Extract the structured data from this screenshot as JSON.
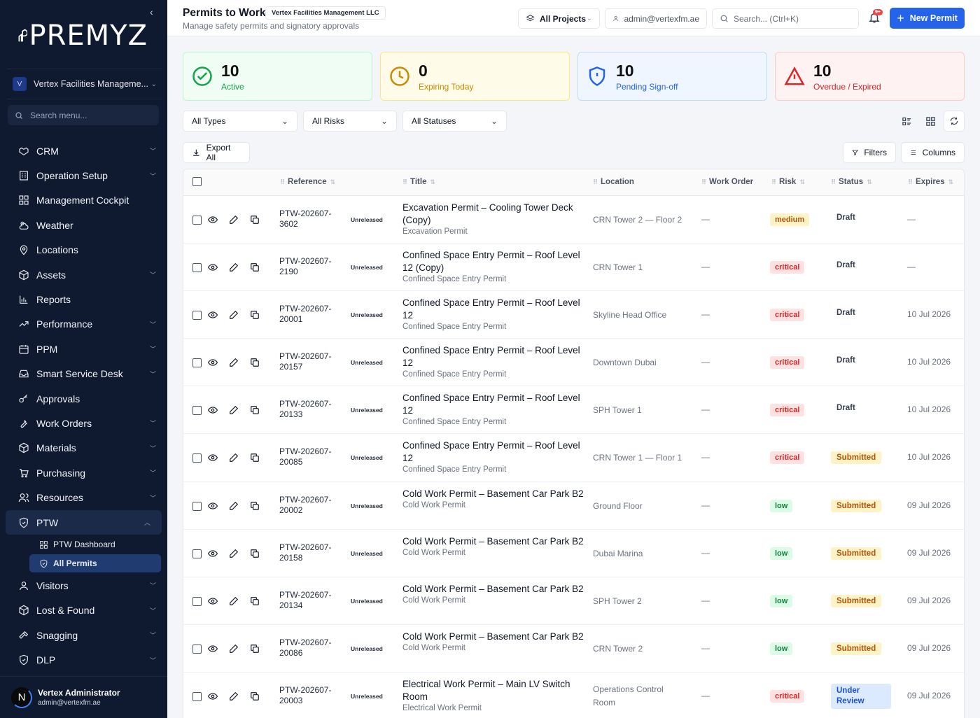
{
  "brand": {
    "logo_text": "PREMYZ"
  },
  "org": {
    "initial": "V",
    "name": "Vertex Facilities Manageme..."
  },
  "menu_search": {
    "placeholder": "Search menu..."
  },
  "nav": [
    {
      "label": "CRM",
      "icon": "handshake-icon",
      "chevron": true
    },
    {
      "label": "Operation Setup",
      "icon": "building-icon",
      "chevron": true
    },
    {
      "label": "Management Cockpit",
      "icon": "grid-icon",
      "chevron": false
    },
    {
      "label": "Weather",
      "icon": "sun-cloud-icon",
      "chevron": false
    },
    {
      "label": "Locations",
      "icon": "map-pin-icon",
      "chevron": false
    },
    {
      "label": "Assets",
      "icon": "box-icon",
      "chevron": true
    },
    {
      "label": "Reports",
      "icon": "bar-chart-icon",
      "chevron": false
    },
    {
      "label": "Performance",
      "icon": "trending-up-icon",
      "chevron": true
    },
    {
      "label": "PPM",
      "icon": "calendar-icon",
      "chevron": true
    },
    {
      "label": "Smart Service Desk",
      "icon": "inbox-icon",
      "chevron": true
    },
    {
      "label": "Approvals",
      "icon": "key-icon",
      "chevron": false
    },
    {
      "label": "Work Orders",
      "icon": "wrench-icon",
      "chevron": true
    },
    {
      "label": "Materials",
      "icon": "package-icon",
      "chevron": true
    },
    {
      "label": "Purchasing",
      "icon": "cart-icon",
      "chevron": true
    },
    {
      "label": "Resources",
      "icon": "users-icon",
      "chevron": true
    },
    {
      "label": "PTW",
      "icon": "shield-icon",
      "chevron": true,
      "active": true
    }
  ],
  "ptw_sub": [
    {
      "label": "PTW Dashboard",
      "icon": "grid-icon"
    },
    {
      "label": "All Permits",
      "icon": "shield-icon",
      "active": true
    }
  ],
  "nav2": [
    {
      "label": "Visitors",
      "icon": "user-icon",
      "chevron": true
    },
    {
      "label": "Lost & Found",
      "icon": "box-icon",
      "chevron": true
    },
    {
      "label": "Snagging",
      "icon": "hammer-icon",
      "chevron": true
    },
    {
      "label": "DLP",
      "icon": "shield-icon",
      "chevron": true
    }
  ],
  "user": {
    "initial": "N",
    "name": "Vertex Administrator",
    "email": "admin@vertexfm.ae"
  },
  "header": {
    "title": "Permits to Work",
    "org_chip": "Vertex Facilities Management LLC",
    "subtitle": "Manage safety permits and signatory approvals",
    "projects": "All Projects",
    "account": "admin@vertexfm.ae",
    "search_placeholder": "Search... (Ctrl+K)",
    "notif_badge": "9+",
    "new_permit": "New Permit"
  },
  "stats": [
    {
      "value": "10",
      "label": "Active",
      "color": "#16a34a"
    },
    {
      "value": "0",
      "label": "Expiring Today",
      "color": "#ca8a04"
    },
    {
      "value": "10",
      "label": "Pending Sign-off",
      "color": "#2563eb"
    },
    {
      "value": "10",
      "label": "Overdue / Expired",
      "color": "#dc2626"
    }
  ],
  "filters": {
    "types": "All Types",
    "risks": "All Risks",
    "statuses": "All Statuses"
  },
  "actions": {
    "export": "Export All",
    "filters": "Filters",
    "columns": "Columns"
  },
  "columns": [
    "Reference",
    "Title",
    "Location",
    "Work Order",
    "Risk",
    "Status",
    "Expires"
  ],
  "rows": [
    {
      "ref": "PTW-202607-3602",
      "tag": "Unreleased",
      "title": "Excavation Permit – Cooling Tower Deck (Copy)",
      "type": "Excavation Permit",
      "location": "CRN Tower 2 — Floor 2",
      "wo": "—",
      "risk": "medium",
      "status": "Draft",
      "expires": "—"
    },
    {
      "ref": "PTW-202607-2190",
      "tag": "Unreleased",
      "title": "Confined Space Entry Permit – Roof Level 12 (Copy)",
      "type": "Confined Space Entry Permit",
      "location": "CRN Tower 1",
      "wo": "—",
      "risk": "critical",
      "status": "Draft",
      "expires": "—"
    },
    {
      "ref": "PTW-202607-20001",
      "tag": "Unreleased",
      "title": "Confined Space Entry Permit – Roof Level 12",
      "type": "Confined Space Entry Permit",
      "location": "Skyline Head Office",
      "wo": "—",
      "risk": "critical",
      "status": "Draft",
      "expires": "10 Jul 2026"
    },
    {
      "ref": "PTW-202607-20157",
      "tag": "Unreleased",
      "title": "Confined Space Entry Permit – Roof Level 12",
      "type": "Confined Space Entry Permit",
      "location": "Downtown Dubai",
      "wo": "—",
      "risk": "critical",
      "status": "Draft",
      "expires": "10 Jul 2026"
    },
    {
      "ref": "PTW-202607-20133",
      "tag": "Unreleased",
      "title": "Confined Space Entry Permit – Roof Level 12",
      "type": "Confined Space Entry Permit",
      "location": "SPH Tower 1",
      "wo": "—",
      "risk": "critical",
      "status": "Draft",
      "expires": "10 Jul 2026"
    },
    {
      "ref": "PTW-202607-20085",
      "tag": "Unreleased",
      "title": "Confined Space Entry Permit – Roof Level 12",
      "type": "Confined Space Entry Permit",
      "location": "CRN Tower 1 — Floor 1",
      "wo": "—",
      "risk": "critical",
      "status": "Submitted",
      "expires": "10 Jul 2026"
    },
    {
      "ref": "PTW-202607-20002",
      "tag": "Unreleased",
      "title": "Cold Work Permit – Basement Car Park B2",
      "type": "Cold Work Permit",
      "location": "Ground Floor",
      "wo": "—",
      "risk": "low",
      "status": "Submitted",
      "expires": "09 Jul 2026"
    },
    {
      "ref": "PTW-202607-20158",
      "tag": "Unreleased",
      "title": "Cold Work Permit – Basement Car Park B2",
      "type": "Cold Work Permit",
      "location": "Dubai Marina",
      "wo": "—",
      "risk": "low",
      "status": "Submitted",
      "expires": "09 Jul 2026"
    },
    {
      "ref": "PTW-202607-20134",
      "tag": "Unreleased",
      "title": "Cold Work Permit – Basement Car Park B2",
      "type": "Cold Work Permit",
      "location": "SPH Tower 2",
      "wo": "—",
      "risk": "low",
      "status": "Submitted",
      "expires": "09 Jul 2026"
    },
    {
      "ref": "PTW-202607-20086",
      "tag": "Unreleased",
      "title": "Cold Work Permit – Basement Car Park B2",
      "type": "Cold Work Permit",
      "location": "CRN Tower 2",
      "wo": "—",
      "risk": "low",
      "status": "Submitted",
      "expires": "09 Jul 2026"
    },
    {
      "ref": "PTW-202607-20003",
      "tag": "Unreleased",
      "title": "Electrical Work Permit – Main LV Switch Room",
      "type": "Electrical Work Permit",
      "location": "Operations Control Room",
      "wo": "—",
      "risk": "critical",
      "status": "Under Review",
      "expires": "09 Jul 2026"
    }
  ]
}
